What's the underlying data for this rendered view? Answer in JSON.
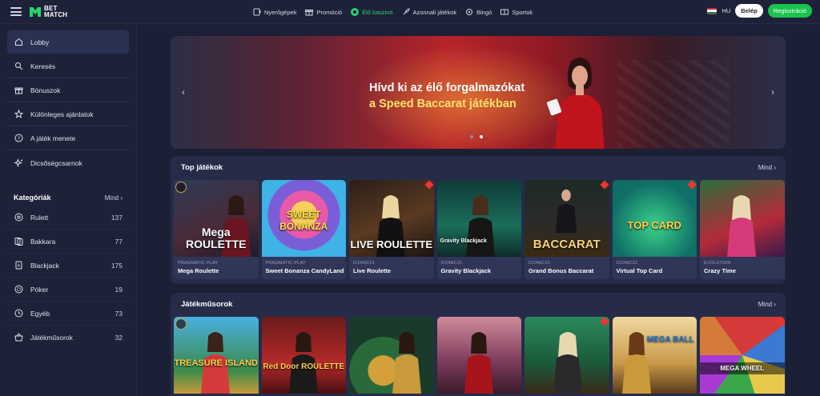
{
  "header": {
    "logo": {
      "line1": "BET",
      "line2": "MATCH"
    },
    "nav": [
      {
        "label": "Nyerőgépek",
        "icon": "slot-machine-icon"
      },
      {
        "label": "Promóció",
        "icon": "gift-icon"
      },
      {
        "label": "Élő kaszinó",
        "icon": "live-icon",
        "active": true
      },
      {
        "label": "Azonnali játékok",
        "icon": "rocket-icon"
      },
      {
        "label": "Bingó",
        "icon": "bingo-icon"
      },
      {
        "label": "Sportok",
        "icon": "sports-icon"
      }
    ],
    "language": "HU",
    "login_label": "Belép",
    "register_label": "Regisztráció",
    "colors": {
      "accent": "#18c44c",
      "active_nav": "#29d36a"
    }
  },
  "sidebar": {
    "menu": [
      {
        "label": "Lobby",
        "icon": "home-icon",
        "active": true
      },
      {
        "label": "Keresés",
        "icon": "search-icon"
      },
      {
        "label": "Bónuszok",
        "icon": "gift-icon"
      },
      {
        "label": "Különleges ajánlatok",
        "icon": "star-icon"
      },
      {
        "label": "A játék menete",
        "icon": "help-icon"
      },
      {
        "label": "Dicsőségcsarnok",
        "icon": "sparkle-icon"
      }
    ],
    "categories_title": "Kategóriák",
    "categories_all": "Mind",
    "categories": [
      {
        "label": "Rulett",
        "count": "137",
        "icon": "roulette-icon"
      },
      {
        "label": "Bakkara",
        "count": "77",
        "icon": "cards-icon"
      },
      {
        "label": "Blackjack",
        "count": "175",
        "icon": "blackjack-icon"
      },
      {
        "label": "Póker",
        "count": "19",
        "icon": "poker-chip-icon"
      },
      {
        "label": "Egyéb",
        "count": "73",
        "icon": "dice-icon"
      },
      {
        "label": "Játékműsorok",
        "count": "32",
        "icon": "show-icon"
      }
    ]
  },
  "banner": {
    "line1": "Hívd ki az élő forgalmazókat",
    "line2": "a Speed Baccarat játékban",
    "slides": 2,
    "active_slide": 2
  },
  "top_games": {
    "title": "Top játékok",
    "more": "Mind",
    "games": [
      {
        "provider": "PRAGMATIC PLAY",
        "name": "Mega Roulette",
        "art": "Mega ROULETTE"
      },
      {
        "provider": "PRAGMATIC PLAY",
        "name": "Sweet Bonanza CandyLand",
        "art": "SWEET BONANZA"
      },
      {
        "provider": "ICONIC21",
        "name": "Live Roulette",
        "art": "LIVE ROULETTE"
      },
      {
        "provider": "ICONIC21",
        "name": "Gravity Blackjack",
        "art": "Gravity Blackjack"
      },
      {
        "provider": "ICONIC21",
        "name": "Grand Bonus Baccarat",
        "art": "BACCARAT"
      },
      {
        "provider": "ICONIC21",
        "name": "Virtual Top Card",
        "art": "TOP CARD"
      },
      {
        "provider": "EVOLUTION",
        "name": "Crazy Time",
        "art": ""
      }
    ]
  },
  "game_shows": {
    "title": "Játékműsorok",
    "more": "Mind",
    "games": [
      {
        "art": "TREASURE ISLAND"
      },
      {
        "art": "Red Door ROULETTE"
      },
      {
        "art": ""
      },
      {
        "art": ""
      },
      {
        "art": ""
      },
      {
        "art": "MEGA BALL"
      },
      {
        "art": "MEGA WHEEL"
      }
    ]
  }
}
